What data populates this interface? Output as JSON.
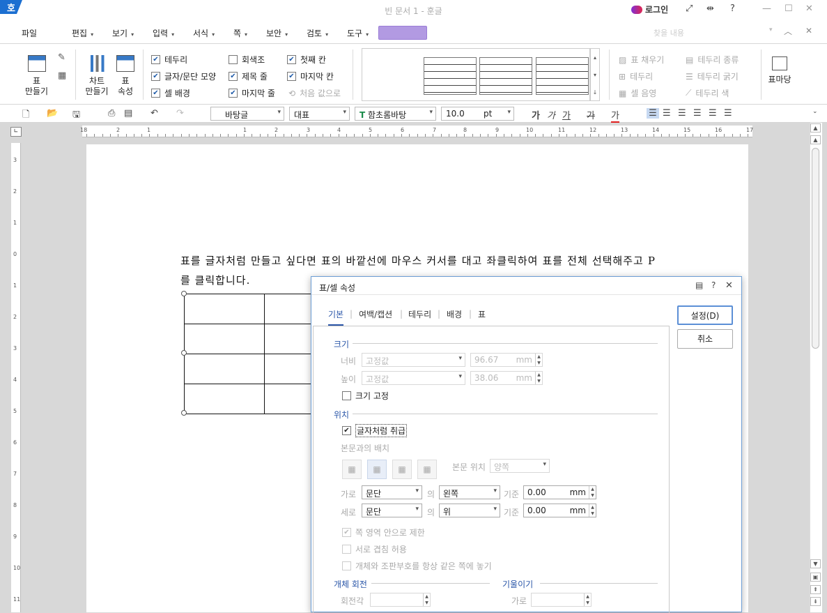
{
  "window": {
    "title": "빈 문서 1 - 훈글",
    "logo": "호",
    "login_label": "로그인",
    "help": "?"
  },
  "menus": [
    "파일",
    "편집",
    "보기",
    "입력",
    "서식",
    "쪽",
    "보안",
    "검토",
    "도구"
  ],
  "search_placeholder": "찾을 내용",
  "ribbon": {
    "table_btn": "표",
    "table_btn2": "만들기",
    "chart_btn": "차트",
    "chart_btn2": "만들기",
    "props_btn": "표",
    "props_btn2": "속성",
    "checks": [
      {
        "label": "테두리",
        "checked": true
      },
      {
        "label": "글자/문단 모양",
        "checked": true
      },
      {
        "label": "셀 배경",
        "checked": true
      },
      {
        "label": "회색조",
        "checked": false
      },
      {
        "label": "제목 줄",
        "checked": true
      },
      {
        "label": "마지막 줄",
        "checked": true
      },
      {
        "label": "첫째 칸",
        "checked": true
      },
      {
        "label": "마지막 칸",
        "checked": true
      }
    ],
    "reset_label": "처음 값으로",
    "right_tools": [
      "표 채우기",
      "테두리",
      "셀 음영",
      "테두리 종류",
      "테두리 굵기",
      "테두리 색"
    ],
    "table_yard": "표마당"
  },
  "toolbar": {
    "style": "바탕글",
    "lang": "대표",
    "font": "함초롬바탕",
    "size": "10.0",
    "unit": "pt",
    "bold": "가",
    "italic": "가",
    "underline": "가",
    "strike": "가",
    "color": "가"
  },
  "ruler": {
    "h_numbers": [
      "2",
      "1",
      "1",
      "2",
      "3",
      "4",
      "5",
      "6",
      "7",
      "8",
      "9",
      "10",
      "11",
      "12",
      "13",
      "14",
      "15",
      "16",
      "17",
      "18"
    ],
    "v_numbers": [
      "3",
      "2",
      "1",
      "0",
      "1",
      "2",
      "3",
      "4",
      "5",
      "6",
      "7",
      "8",
      "9",
      "10",
      "11"
    ]
  },
  "document": {
    "text": "표를 글자처럼 만들고 싶다면 표의 바깥선에 마우스 커서를 대고 좌클릭하여 표를 전체 선택해주고 P를 클릭합니다."
  },
  "dialog": {
    "title": "표/셀 속성",
    "tabs": [
      "기본",
      "여백/캡션",
      "테두리",
      "배경",
      "표"
    ],
    "ok": "설정(D)",
    "cancel": "취소",
    "size_section": "크기",
    "width_label": "너비",
    "width_mode": "고정값",
    "width_value": "96.67",
    "height_label": "높이",
    "height_mode": "고정값",
    "height_value": "38.06",
    "unit_mm": "mm",
    "fix_size": "크기 고정",
    "position_section": "위치",
    "treat_as_char": "글자처럼 취급",
    "body_layout": "본문과의 배치",
    "body_pos_label": "본문 위치",
    "body_pos_value": "양쪽",
    "horiz_label": "가로",
    "horiz_ref": "문단",
    "of": "의",
    "horiz_align": "왼쪽",
    "base": "기준",
    "horiz_value": "0.00",
    "vert_label": "세로",
    "vert_ref": "문단",
    "vert_align": "위",
    "vert_value": "0.00",
    "limit_page": "쪽 영역 안으로 제한",
    "allow_overlap": "서로 겹침 허용",
    "same_page": "개체와 조판부호를 항상 같은 쪽에 놓기",
    "rotate_section": "개체 회전",
    "rotate_label": "회전각",
    "tilt_section": "기울이기",
    "tilt_label": "가로"
  }
}
